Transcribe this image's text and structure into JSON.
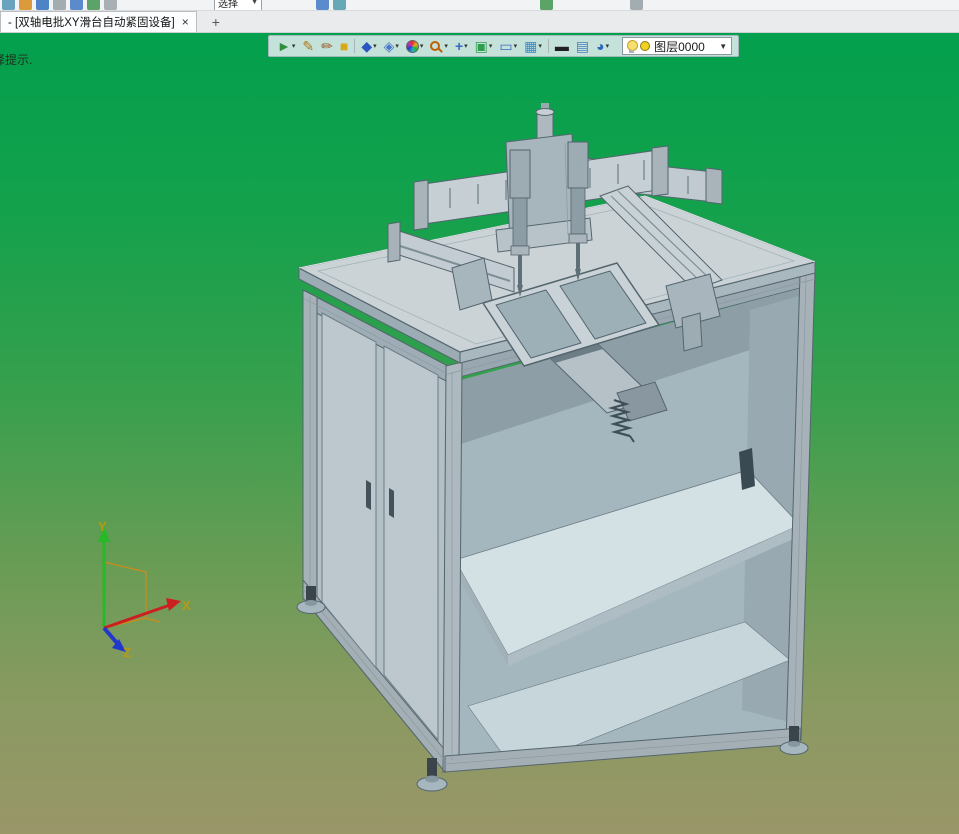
{
  "window": {
    "top_strip": {
      "dropdown_label": "选择",
      "dropdown_caret": "▼"
    },
    "tab": {
      "title": "- [双轴电批XY滑台自动紧固设备]",
      "close_glyph": "×",
      "new_tab_glyph": "+"
    }
  },
  "hint": {
    "text": "择提示."
  },
  "toolbar": {
    "caret": "▾",
    "icons": [
      {
        "name": "select-tool-icon",
        "glyph": "►"
      },
      {
        "name": "pen-tool-icon",
        "glyph": "✎"
      },
      {
        "name": "brush-tool-icon",
        "glyph": "✏"
      },
      {
        "name": "solid-box-tool-icon",
        "glyph": "■"
      },
      {
        "name": "cube-tool-icon",
        "glyph": "◆"
      },
      {
        "name": "shaded-cube-tool-icon",
        "glyph": "◈"
      },
      {
        "name": "color-wheel-tool-icon",
        "glyph": ""
      },
      {
        "name": "zoom-tool-icon",
        "glyph": ""
      },
      {
        "name": "move-tool-icon",
        "glyph": "+"
      },
      {
        "name": "fit-view-tool-icon",
        "glyph": "▣"
      },
      {
        "name": "frame-view-tool-icon",
        "glyph": "▭"
      },
      {
        "name": "display-mode-tool-icon",
        "glyph": "▦"
      },
      {
        "name": "line-width-tool-icon",
        "glyph": "▬"
      },
      {
        "name": "panel-tool-icon",
        "glyph": "▤"
      },
      {
        "name": "visibility-tool-icon",
        "glyph": "◕"
      }
    ],
    "layer": {
      "label": "图层0000",
      "caret": "▼",
      "bulb_color": "#f6df6e",
      "swatch_color": "#f0d020"
    }
  },
  "viewport": {
    "gradient": [
      "#03a04d 0%",
      "#14a14c 22%",
      "#37a04d 45%",
      "#689c55 66%",
      "#899a61 83%",
      "#999668 100%"
    ],
    "axis_labels": {
      "x": "X",
      "y": "Y",
      "z": "Z"
    },
    "axis_colors": {
      "x": "#cc2020",
      "y": "#28b828",
      "z": "#2238cc"
    },
    "model_color": "#c6ced3"
  }
}
